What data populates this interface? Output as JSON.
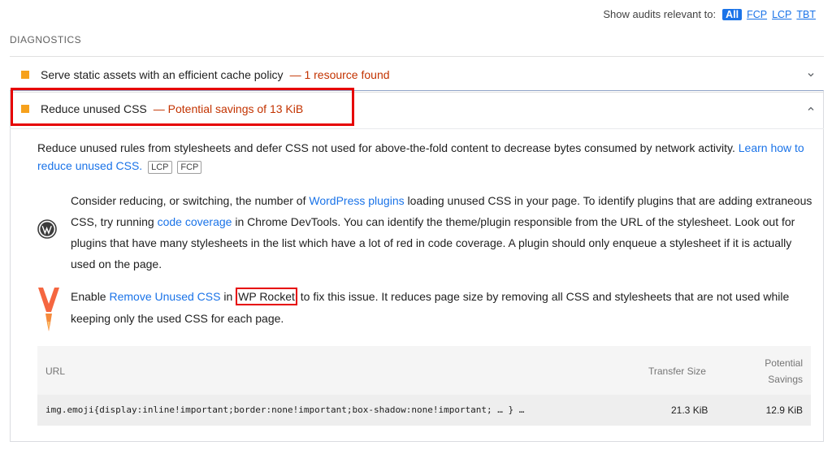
{
  "filter": {
    "label": "Show audits relevant to:",
    "options": [
      "All",
      "FCP",
      "LCP",
      "TBT"
    ]
  },
  "section_title": "DIAGNOSTICS",
  "audits": [
    {
      "title": "Serve static assets with an efficient cache policy",
      "display": "— 1 resource found",
      "state_icon": "chevron-down-icon"
    },
    {
      "title": "Reduce unused CSS",
      "display": "— Potential savings of 13 KiB",
      "state_icon": "chevron-up-icon"
    }
  ],
  "expanded": {
    "description_prefix": "Reduce unused rules from stylesheets and defer CSS not used for above-the-fold content to decrease bytes consumed by network activity.",
    "description_link": "Learn how to reduce unused CSS.",
    "tags": [
      "LCP",
      "FCP"
    ],
    "wp_hint": {
      "part1": "Consider reducing, or switching, the number of ",
      "link1": "WordPress plugins",
      "part2": " loading unused CSS in your page. To identify plugins that are adding extraneous CSS, try running ",
      "link2": "code coverage",
      "part3": " in Chrome DevTools. You can identify the theme/plugin responsible from the URL of the stylesheet. Look out for plugins that have many stylesheets in the list which have a lot of red in code coverage. A plugin should only enqueue a stylesheet if it is actually used on the page."
    },
    "rocket_hint": {
      "part1": "Enable ",
      "link1": "Remove Unused CSS",
      "part2": " in ",
      "highlight": "WP Rocket",
      "part3": " to fix this issue. It reduces page size by removing all CSS and stylesheets that are not used while keeping only the used CSS for each page."
    },
    "table": {
      "headers": {
        "url": "URL",
        "transfer": "Transfer Size",
        "savings_line1": "Potential",
        "savings_line2": "Savings"
      },
      "rows": [
        {
          "url": "img.emoji{display:inline!important;border:none!important;box-shadow:none!important; … } …",
          "transfer": "21.3 KiB",
          "savings": "12.9 KiB"
        }
      ]
    }
  },
  "colors": {
    "accent": "#1a73e8",
    "warning": "#f6a11c",
    "savings": "#c33300",
    "highlight_box": "#e60000"
  }
}
